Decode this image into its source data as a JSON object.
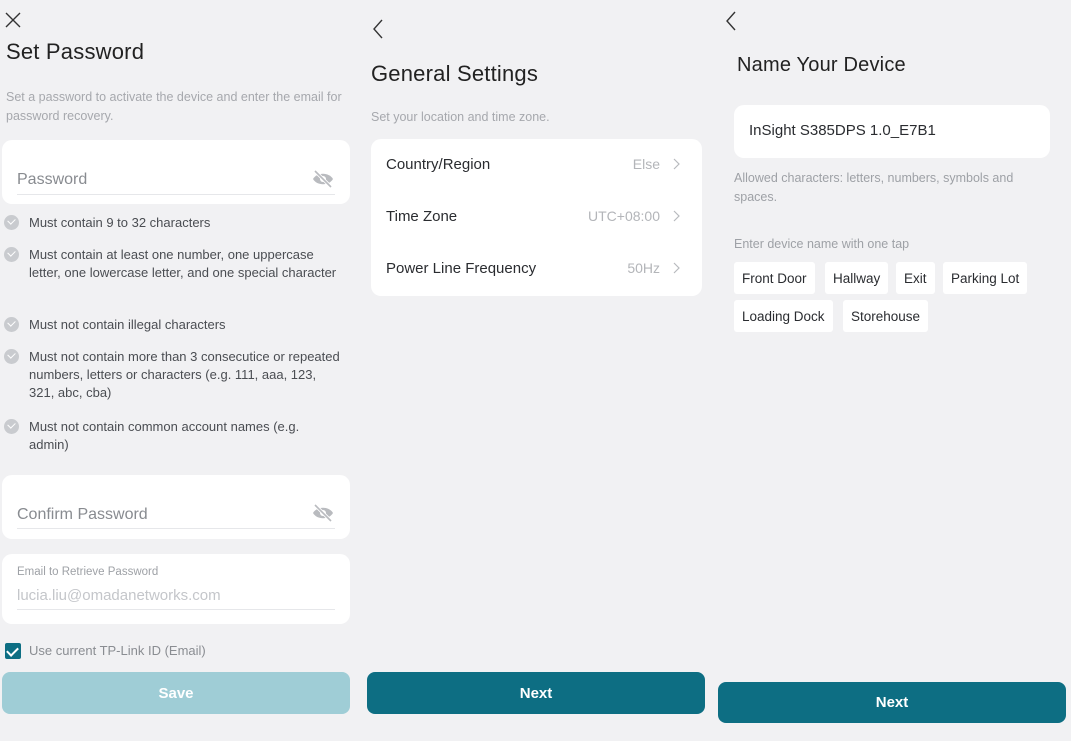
{
  "set_password": {
    "title": "Set Password",
    "description": "Set a password to activate the device and enter the email for password recovery.",
    "password_placeholder": "Password",
    "rules": [
      "Must contain 9 to 32 characters",
      "Must contain at least one number, one uppercase letter, one lowercase letter, and one special character",
      "Must not contain illegal characters",
      "Must not contain more than 3 consecutice or repeated numbers, letters or characters (e.g. 111, aaa, 123, 321, abc, cba)",
      "Must not contain common account names (e.g. admin)"
    ],
    "confirm_placeholder": "Confirm Password",
    "email_label": "Email to Retrieve Password",
    "email_value": "lucia.liu@omadanetworks.com",
    "use_current_label": "Use current TP-Link ID (Email)",
    "use_current_checked": true,
    "save_label": "Save"
  },
  "general_settings": {
    "title": "General Settings",
    "description": "Set your location and time zone.",
    "rows": [
      {
        "label": "Country/Region",
        "value": "Else"
      },
      {
        "label": "Time Zone",
        "value": "UTC+08:00"
      },
      {
        "label": "Power Line Frequency",
        "value": "50Hz"
      }
    ],
    "next_label": "Next"
  },
  "name_device": {
    "title": "Name Your Device",
    "device_name": "InSight S385DPS 1.0_E7B1",
    "allowed_hint": "Allowed characters: letters, numbers, symbols and spaces.",
    "quick_label": "Enter device name with one tap",
    "quick_names": [
      "Front Door",
      "Hallway",
      "Exit",
      "Parking Lot",
      "Loading Dock",
      "Storehouse"
    ],
    "next_label": "Next"
  },
  "colors": {
    "primary": "#0d6e83",
    "primary_disabled": "#9fcdd6",
    "background": "#f1f1f3"
  },
  "icons": [
    "close-icon",
    "eye-off-icon",
    "check-circle-icon",
    "checkbox-checked-icon",
    "back-arrow-icon",
    "chevron-right-icon"
  ]
}
